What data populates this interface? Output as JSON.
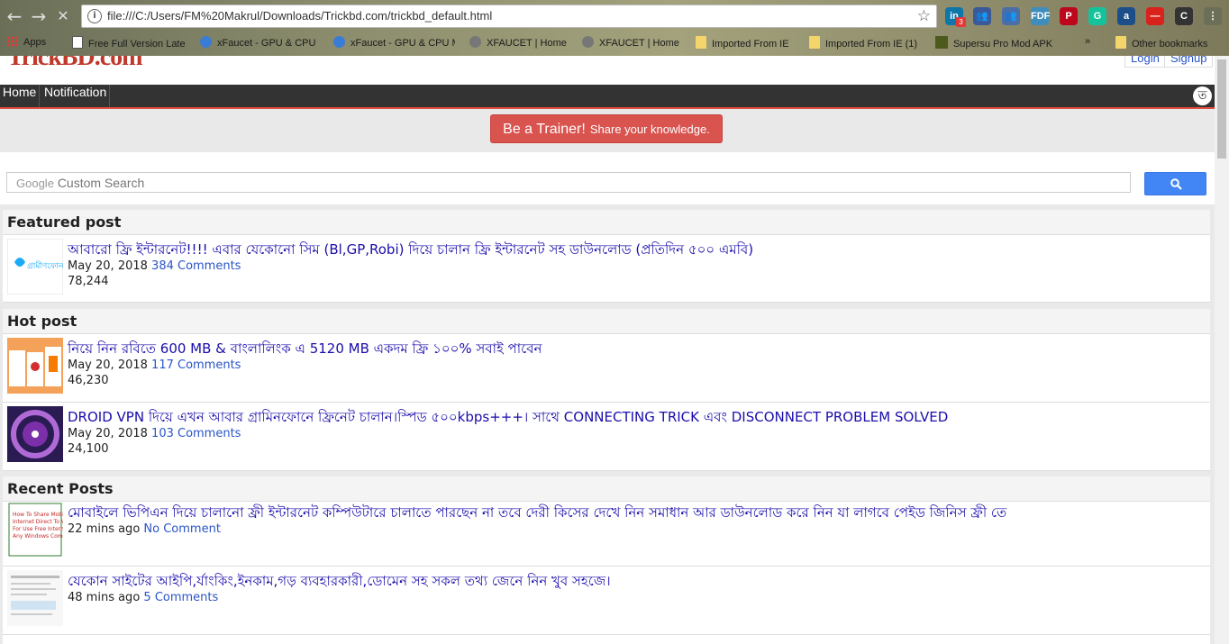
{
  "browser": {
    "url": "file:///C:/Users/FM%20Makrul/Downloads/Trickbd.com/trickbd_default.html",
    "nav": {
      "back": "←",
      "forward": "→",
      "reload": "✕"
    },
    "extensions": [
      {
        "label": "in",
        "color": "#0e76a8",
        "badge": "3"
      },
      {
        "label": "👥",
        "color": "#3b5998"
      },
      {
        "label": "👥",
        "color": "#4a6ea8"
      },
      {
        "label": "FDF",
        "color": "#3d8ebd"
      },
      {
        "label": "P",
        "color": "#bd081c"
      },
      {
        "label": "G",
        "color": "#15c39a"
      },
      {
        "label": "a",
        "color": "#1c4f8a"
      },
      {
        "label": "—",
        "color": "#d9221c"
      },
      {
        "label": "C",
        "color": "#333333"
      },
      {
        "label": "⋮",
        "color": "#6b6f58"
      }
    ],
    "bookmarks": [
      {
        "label": "Apps",
        "type": "apps"
      },
      {
        "label": "Free Full Version Late",
        "type": "page"
      },
      {
        "label": "xFaucet - GPU & CPU",
        "type": "faucet"
      },
      {
        "label": "xFaucet - GPU & CPU M",
        "type": "faucet"
      },
      {
        "label": "XFAUCET | Home",
        "type": "coin"
      },
      {
        "label": "XFAUCET | Home",
        "type": "coin"
      },
      {
        "label": "Imported From IE",
        "type": "folder"
      },
      {
        "label": "Imported From IE (1)",
        "type": "folder"
      },
      {
        "label": "Supersu Pro Mod APK",
        "type": "ah"
      },
      {
        "label": "»",
        "type": "more"
      },
      {
        "label": "Other bookmarks",
        "type": "folder"
      }
    ]
  },
  "site": {
    "logo": "TrickBD.com",
    "login": "Login",
    "signup": "Signup",
    "nav": {
      "home": "Home",
      "notification": "Notification",
      "lang": "ত"
    },
    "trainer": {
      "big": "Be a Trainer!",
      "small": "Share your knowledge."
    },
    "search": {
      "brand": "Google",
      "placeholder": "Custom Search"
    }
  },
  "featured": {
    "title": "Featured post",
    "posts": [
      {
        "title": "আবারো ফ্রি ইন্টারনেট!!!! এবার যেকোনো সিম (Bl,GP,Robi) দিয়ে চালান ফ্রি ইন্টারনেট সহ ডাউনলোড (প্রতিদিন ৫০০ এমবি)",
        "date": "May 20, 2018",
        "comments": "384 Comments",
        "views": "78,244",
        "thumb": "gp"
      }
    ]
  },
  "hot": {
    "title": "Hot post",
    "posts": [
      {
        "title": "নিয়ে নিন রবিতে 600 MB & বাংলালিংক এ 5120 MB একদম ফ্রি ১০০% সবাই পাবেন",
        "date": "May 20, 2018",
        "comments": "117 Comments",
        "views": "46,230",
        "thumb": "robi"
      },
      {
        "title": "DROID VPN দিয়ে এখন আবার গ্রামিনফোনে ফ্রিনেট চালান।স্পিড ৫০০kbps+++। সাথে CONNECTING TRICK এবং DISCONNECT PROBLEM SOLVED",
        "date": "May 20, 2018",
        "comments": "103 Comments",
        "views": "24,100",
        "thumb": "vpn"
      }
    ]
  },
  "recent": {
    "title": "Recent Posts",
    "posts": [
      {
        "title": "মোবাইলে ভিপিএন দিয়ে চালানো ফ্রী ইন্টারনেট কম্পিউটারে চালাতে পারছেন না তবে দেরী কিসের দেখে নিন সমাধান আর ডাউনলোড করে নিন যা লাগবে পেইড জিনিস ফ্রী তে",
        "date": "22 mins ago",
        "comments": "No Comment",
        "thumb": "txt"
      },
      {
        "title": "যেকোন সাইটের আইপি,র্যাংকিং,ইনকাম,গড় ব্যবহারকারী,ডোমেন সহ সকল তথ্য জেনে নিন খুব সহজে।",
        "date": "48 mins ago",
        "comments": "5 Comments",
        "thumb": "doc"
      }
    ]
  }
}
